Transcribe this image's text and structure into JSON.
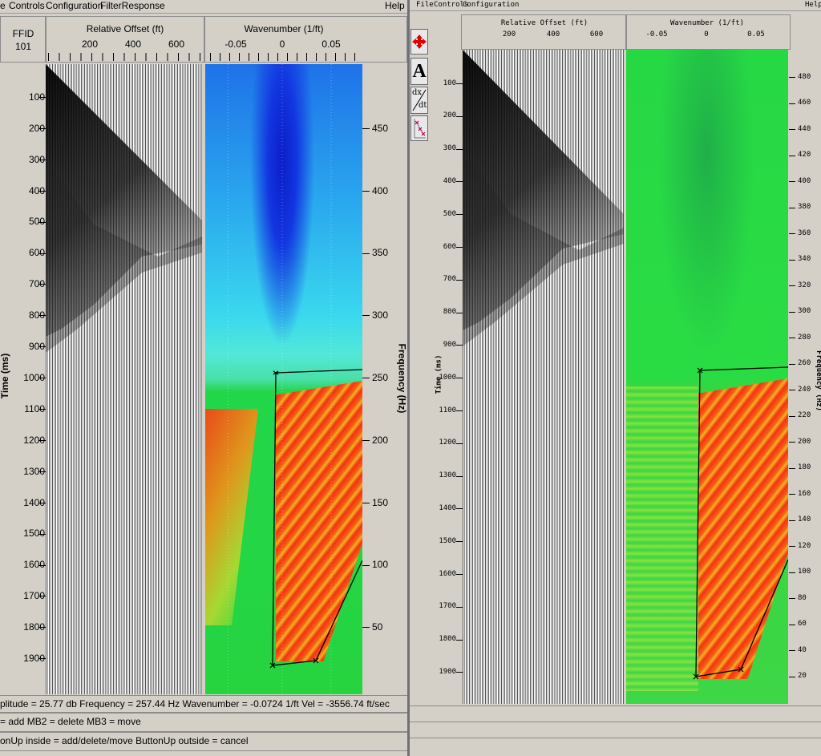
{
  "left": {
    "menu": [
      "e",
      "Controls",
      "Configuration",
      "FilterResponse"
    ],
    "help": "Help",
    "ffid_label": "FFID",
    "ffid_value": "101",
    "offset_title": "Relative Offset (ft)",
    "offset_ticks": [
      "200",
      "400",
      "600"
    ],
    "wavenumber_title": "Wavenumber (1/ft)",
    "wavenumber_ticks": [
      "-0.05",
      "0",
      "0.05"
    ],
    "time_label": "Time (ms)",
    "time_ticks": [
      "100",
      "200",
      "300",
      "400",
      "500",
      "600",
      "700",
      "800",
      "900",
      "1000",
      "1100",
      "1200",
      "1300",
      "1400",
      "1500",
      "1600",
      "1700",
      "1800",
      "1900"
    ],
    "freq_label": "Frequency (Hz)",
    "freq_ticks": [
      "450",
      "400",
      "350",
      "300",
      "250",
      "200",
      "150",
      "100",
      "50"
    ],
    "status_line": "plitude = 25.77 db  Frequency = 257.44 Hz  Wavenumber = -0.0724 1/ft  Vel = -3556.74 ft/sec",
    "mouse_line": "= add  MB2 = delete  MB3 = move",
    "button_line": "onUp inside = add/delete/move  ButtonUp outside = cancel"
  },
  "right": {
    "menu": [
      "File",
      "Controls",
      "Configuration"
    ],
    "help": "Help",
    "offset_title": "Relative Offset (ft)",
    "offset_ticks": [
      "200",
      "400",
      "600"
    ],
    "wavenumber_title": "Wavenumber (1/ft)",
    "wavenumber_ticks": [
      "-0.05",
      "0",
      "0.05"
    ],
    "time_label": "Time (ms)",
    "time_ticks": [
      "100",
      "200",
      "300",
      "400",
      "500",
      "600",
      "700",
      "800",
      "900",
      "1000",
      "1100",
      "1200",
      "1300",
      "1400",
      "1500",
      "1600",
      "1700",
      "1800",
      "1900"
    ],
    "freq_label": "Frequency (Hz)",
    "freq_ticks": [
      "480",
      "460",
      "440",
      "420",
      "400",
      "380",
      "360",
      "340",
      "320",
      "300",
      "280",
      "260",
      "240",
      "220",
      "200",
      "180",
      "160",
      "140",
      "120",
      "100",
      "80",
      "60",
      "40",
      "20"
    ],
    "tools": [
      "move-tool-icon",
      "text-tool-icon",
      "derivative-tool-icon",
      "velocity-pick-tool-icon"
    ],
    "tool_text_glyph": "A",
    "tool_deriv_top": "dx",
    "tool_deriv_bottom": "dt"
  },
  "colors": {
    "panel": "#d4d0c8",
    "trace": "#545454",
    "spec_blue": "#1a2fd0",
    "spec_cyan": "#3fdcf0",
    "spec_green": "#22d64a",
    "spec_red": "#ff2a10"
  }
}
